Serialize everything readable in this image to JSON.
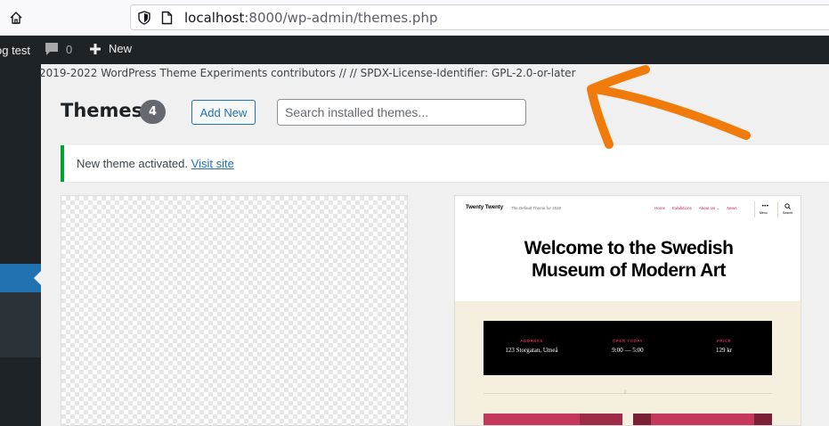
{
  "browser": {
    "url_host": "localhost",
    "url_rest": ":8000/wp-admin/themes.php"
  },
  "adminbar": {
    "site_name": "og test",
    "comment_count": "0",
    "new_label": "New"
  },
  "footer_text": "2019-2022 WordPress Theme Experiments contributors // // SPDX-License-Identifier: GPL-2.0-or-later",
  "page": {
    "title": "Themes",
    "theme_count": "4",
    "add_new_label": "Add New",
    "search_placeholder": "Search installed themes..."
  },
  "notice": {
    "text": "New theme activated.",
    "link": "Visit site"
  },
  "theme_preview": {
    "brand": "Twenty Twenty",
    "tagline": "The Default Theme for 2020",
    "nav": [
      "Home",
      "Exhibitions",
      "About Us ⌄",
      "News"
    ],
    "menu_label": "Menu",
    "search_label": "Search",
    "hero_line1": "Welcome to the Swedish",
    "hero_line2": "Museum of Modern Art",
    "info": [
      {
        "label": "ADDRESS",
        "value": "123 Storgatan, Umeå"
      },
      {
        "label": "OPEN TODAY",
        "value": "9:00 — 5:00"
      },
      {
        "label": "PRICE",
        "value": "129 kr"
      }
    ]
  },
  "colors": {
    "wp_blue": "#2271b1",
    "admin_dark": "#1d2327",
    "notice_green": "#00a32a",
    "annotation_orange": "#f07b0b",
    "tt_accent": "#cd2653"
  }
}
